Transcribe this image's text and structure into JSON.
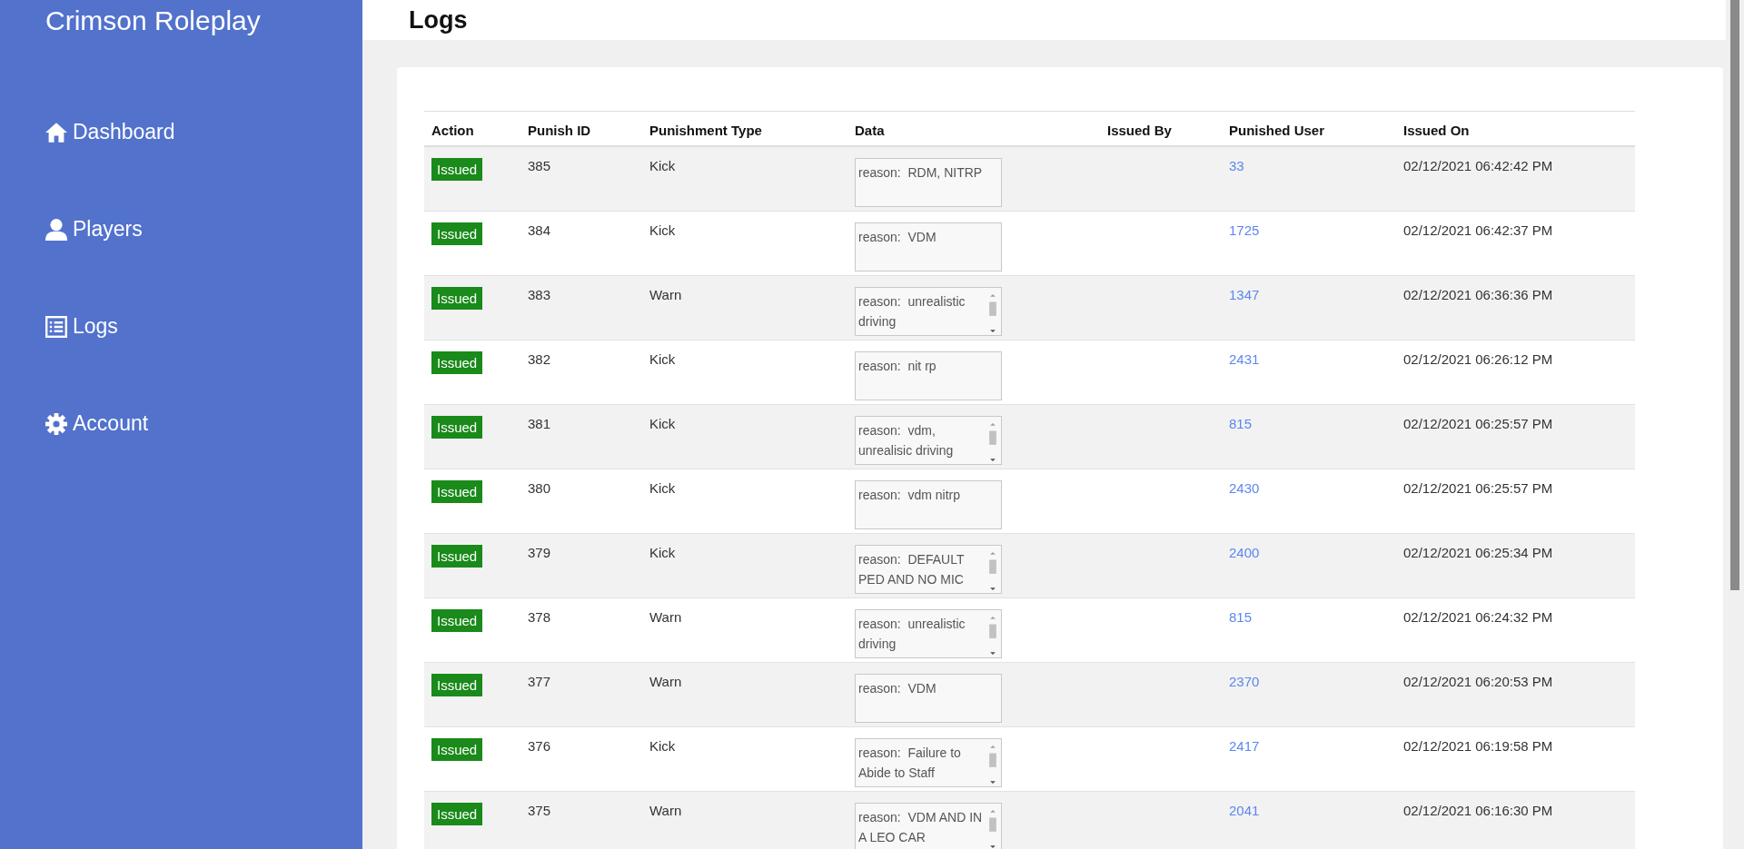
{
  "sidebar": {
    "brand": "Crimson Roleplay",
    "items": [
      {
        "label": "Dashboard"
      },
      {
        "label": "Players"
      },
      {
        "label": "Logs"
      },
      {
        "label": "Account"
      }
    ]
  },
  "header": {
    "title": "Logs"
  },
  "table": {
    "columns": [
      "Action",
      "Punish ID",
      "Punishment Type",
      "Data",
      "Issued By",
      "Punished User",
      "Issued On"
    ],
    "rows": [
      {
        "action": "Issued",
        "id": "385",
        "type": "Kick",
        "data": "reason:  RDM, NITRP",
        "scrollable": false,
        "user": "33",
        "issued_on": "02/12/2021 06:42:42 PM"
      },
      {
        "action": "Issued",
        "id": "384",
        "type": "Kick",
        "data": "reason:  VDM",
        "scrollable": false,
        "user": "1725",
        "issued_on": "02/12/2021 06:42:37 PM"
      },
      {
        "action": "Issued",
        "id": "383",
        "type": "Warn",
        "data": "reason:  unrealistic driving",
        "scrollable": true,
        "user": "1347",
        "issued_on": "02/12/2021 06:36:36 PM"
      },
      {
        "action": "Issued",
        "id": "382",
        "type": "Kick",
        "data": "reason:  nit rp",
        "scrollable": false,
        "user": "2431",
        "issued_on": "02/12/2021 06:26:12 PM"
      },
      {
        "action": "Issued",
        "id": "381",
        "type": "Kick",
        "data": "reason:  vdm, unrealisic driving",
        "scrollable": true,
        "user": "815",
        "issued_on": "02/12/2021 06:25:57 PM"
      },
      {
        "action": "Issued",
        "id": "380",
        "type": "Kick",
        "data": "reason:  vdm nitrp",
        "scrollable": false,
        "user": "2430",
        "issued_on": "02/12/2021 06:25:57 PM"
      },
      {
        "action": "Issued",
        "id": "379",
        "type": "Kick",
        "data": "reason:  DEFAULT PED AND NO MIC",
        "scrollable": true,
        "user": "2400",
        "issued_on": "02/12/2021 06:25:34 PM"
      },
      {
        "action": "Issued",
        "id": "378",
        "type": "Warn",
        "data": "reason:  unrealistic driving",
        "scrollable": true,
        "user": "815",
        "issued_on": "02/12/2021 06:24:32 PM"
      },
      {
        "action": "Issued",
        "id": "377",
        "type": "Warn",
        "data": "reason:  VDM",
        "scrollable": false,
        "user": "2370",
        "issued_on": "02/12/2021 06:20:53 PM"
      },
      {
        "action": "Issued",
        "id": "376",
        "type": "Kick",
        "data": "reason:  Failure to Abide to Staff",
        "scrollable": true,
        "user": "2417",
        "issued_on": "02/12/2021 06:19:58 PM"
      },
      {
        "action": "Issued",
        "id": "375",
        "type": "Warn",
        "data": "reason:  VDM AND IN A LEO CAR",
        "scrollable": true,
        "user": "2041",
        "issued_on": "02/12/2021 06:16:30 PM"
      }
    ]
  }
}
